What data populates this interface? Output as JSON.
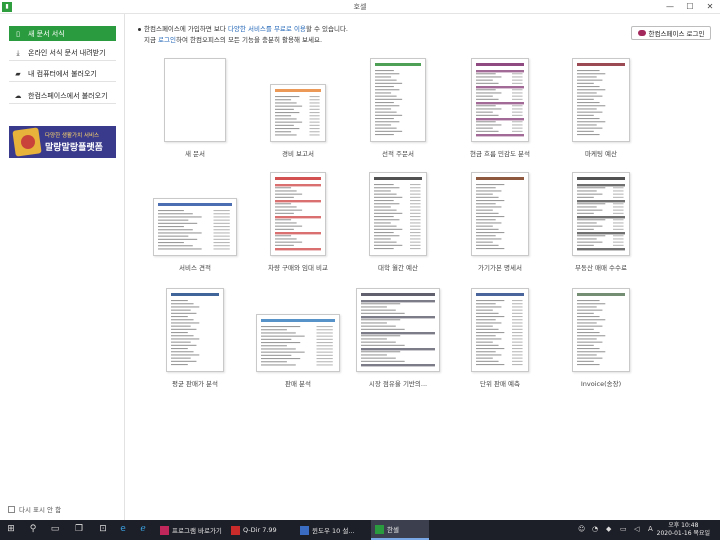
{
  "window": {
    "title": "호셀",
    "minimize": "—",
    "maximize": "☐",
    "close": "✕"
  },
  "sidebar": {
    "items": [
      {
        "label": "새 문서 서식",
        "icon": "new-doc-icon",
        "glyph": "▯"
      },
      {
        "label": "온라인 서식 문서 내려받기",
        "icon": "download-icon",
        "glyph": "⤓"
      },
      {
        "label": "내 컴퓨터에서 불러오기",
        "icon": "folder-icon",
        "glyph": "▰"
      },
      {
        "label": "한컴스페이스에서 불러오기",
        "icon": "cloud-icon",
        "glyph": "☁"
      }
    ],
    "banner": {
      "small": "다양한 생활가치 서비스",
      "big": "말랑말랑플랫폼"
    },
    "dont_show": "다시 표시 안 함"
  },
  "notice": {
    "line1_a": "한컴스페이스에 가입하면 보다 ",
    "line1_link": "다양한 서비스를 무료로 이용",
    "line1_b": "할 수 있습니다.",
    "line2_a": "지금 ",
    "line2_link": "로그인",
    "line2_b": "하여 한컴오피스의 모든 기능을 충분히 활용해 보세요."
  },
  "login_button": "한컴스페이스 로그인",
  "templates": [
    {
      "label": "새 문서"
    },
    {
      "label": "경비 보고서"
    },
    {
      "label": "선적 주문서"
    },
    {
      "label": "현금 흐름 민감도 분석"
    },
    {
      "label": "마케팅 예산"
    },
    {
      "label": "서비스 견적"
    },
    {
      "label": "차량 구매와 임대 비교"
    },
    {
      "label": "대학 월간 예산"
    },
    {
      "label": "가기가본 명세서"
    },
    {
      "label": "부동산 매매 수수료"
    },
    {
      "label": "평균 판매가 분석"
    },
    {
      "label": "판매 분석"
    },
    {
      "label": "시장 점유율 기반의..."
    },
    {
      "label": "단위 판매 예측"
    },
    {
      "label": "Invoice(송장)"
    }
  ],
  "taskbar": {
    "apps": [
      {
        "label": "프로그램 바로가기",
        "color": "#c2275c"
      },
      {
        "label": "Q-Dir 7.99",
        "color": "#c92b2b"
      },
      {
        "label": "윈도우 10 설...",
        "color": "#3a6cc4"
      },
      {
        "label": "한셀",
        "color": "#2a9b3e"
      }
    ],
    "time": "오후 10:48",
    "date": "2020-01-16 목요일"
  },
  "colors": {
    "accent": "#2a9b3e",
    "link": "#2568b8",
    "taskbar": "#1d1f28"
  }
}
